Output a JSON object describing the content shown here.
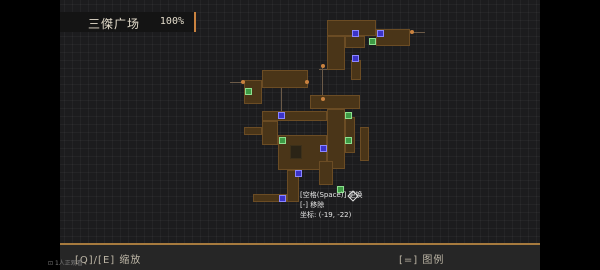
{
  "header": {
    "area_name": "三傑广场",
    "completion": "100%"
  },
  "tooltip": {
    "line1": "[空格(Space)] 更换",
    "line2": "[-] 移除",
    "line3": "坐标: (-19, -22)"
  },
  "footer": {
    "zoom_hint": "[Q]/[E] 缩放",
    "legend_hint": "[=] 图例",
    "corner_text": "1人正观看"
  },
  "legend_colors": {
    "room": "#4a3518",
    "save_marker": "#3e9a45",
    "teleport_marker": "#3b33c9",
    "exit_marker": "#c9823f"
  },
  "markers": [
    {
      "type": "teleport",
      "icon": "teleport-icon"
    },
    {
      "type": "save",
      "icon": "save-icon"
    }
  ]
}
